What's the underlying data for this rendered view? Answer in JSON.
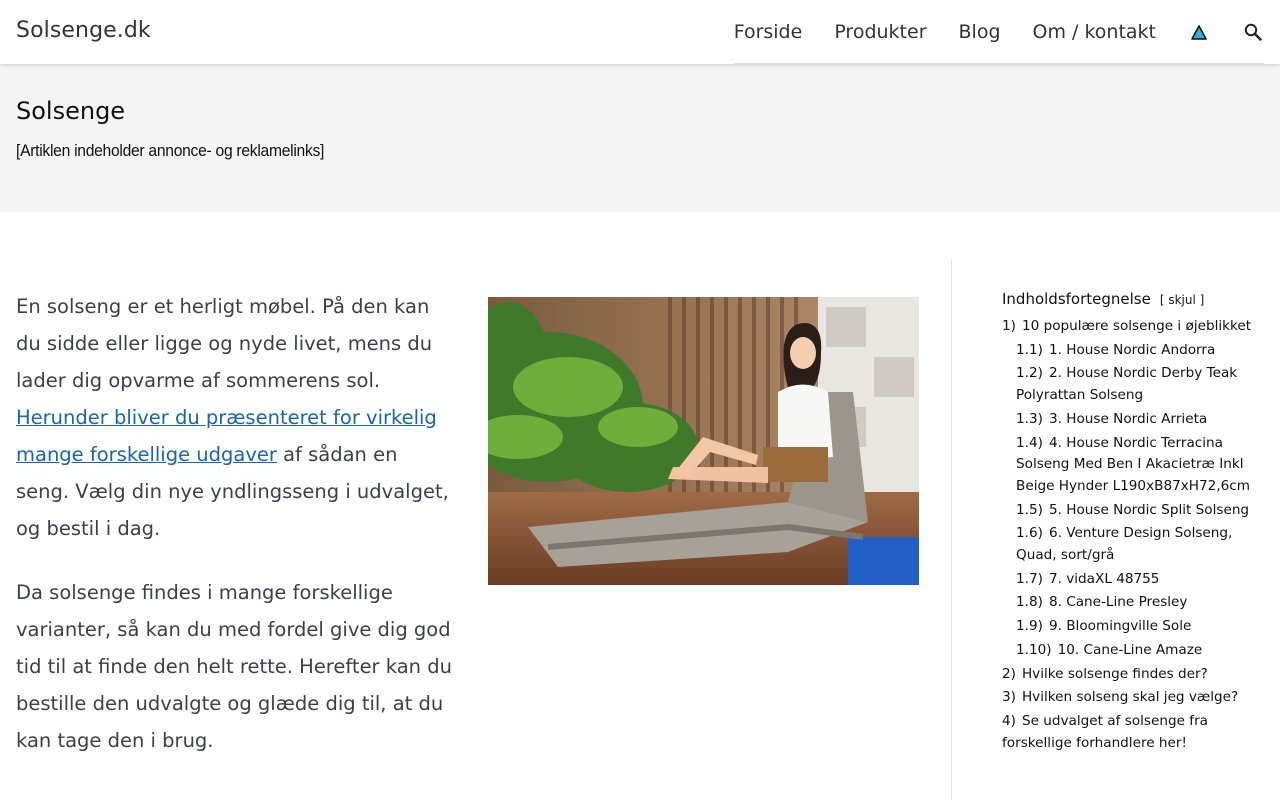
{
  "header": {
    "brand": "Solsenge.dk",
    "nav": [
      "Forside",
      "Produkter",
      "Blog",
      "Om / kontakt"
    ],
    "icons": [
      "warning-triangle-icon",
      "search-icon"
    ]
  },
  "title_band": {
    "title": "Solsenge",
    "disclaimer": "[Artiklen indeholder annonce- og reklamelinks]"
  },
  "content": {
    "p1_before": "En solseng er et herligt møbel. På den kan du sidde eller ligge og nyde livet, mens du lader dig opvarme af sommerens sol. ",
    "p1_link": "Herunder bliver du præsenteret for virkelig mange forskellige udgaver",
    "p1_after": " af sådan en seng. Vælg din nye yndlingsseng i udvalget, og bestil i dag.",
    "p2": "Da solsenge findes i mange forskellige varianter, så kan du med fordel give dig god tid til at finde den helt rette. Herefter kan du bestille den udvalgte og glæde dig til, at du kan tage den i brug."
  },
  "toc": {
    "heading": "Indholdsfortegnelse",
    "toggle_open": "[",
    "toggle_label": "skjul",
    "toggle_close": "]",
    "items": [
      {
        "num": "1)",
        "label": "10 populære solsenge i øjeblikket",
        "level": 1
      },
      {
        "num": "1.1)",
        "label": "1. House Nordic Andorra",
        "level": 2
      },
      {
        "num": "1.2)",
        "label": "2. House Nordic Derby Teak Polyrattan Solseng",
        "level": 2
      },
      {
        "num": "1.3)",
        "label": "3. House Nordic Arrieta",
        "level": 2
      },
      {
        "num": "1.4)",
        "label": "4. House Nordic Terracina Solseng Med Ben I Akacietræ Inkl Beige Hynder L190xB87xH72,6cm",
        "level": 2
      },
      {
        "num": "1.5)",
        "label": "5. House Nordic Split Solseng",
        "level": 2
      },
      {
        "num": "1.6)",
        "label": "6. Venture Design Solseng, Quad, sort/grå",
        "level": 2
      },
      {
        "num": "1.7)",
        "label": "7. vidaXL 48755",
        "level": 2
      },
      {
        "num": "1.8)",
        "label": "8. Cane-Line Presley",
        "level": 2
      },
      {
        "num": "1.9)",
        "label": "9. Bloomingville Sole",
        "level": 2
      },
      {
        "num": "1.10)",
        "label": "10. Cane-Line Amaze",
        "level": 2
      },
      {
        "num": "2)",
        "label": "Hvilke solsenge findes der?",
        "level": 1
      },
      {
        "num": "3)",
        "label": "Hvilken solseng skal jeg vælge?",
        "level": 1
      },
      {
        "num": "4)",
        "label": "Se udvalget af solsenge fra forskellige forhandlere her!",
        "level": 1
      }
    ]
  },
  "colors": {
    "link": "#1a64a8",
    "body_text": "#3a3f4a",
    "title_band_bg": "#f4f4f4",
    "warning_icon": "#2bb3d9"
  }
}
